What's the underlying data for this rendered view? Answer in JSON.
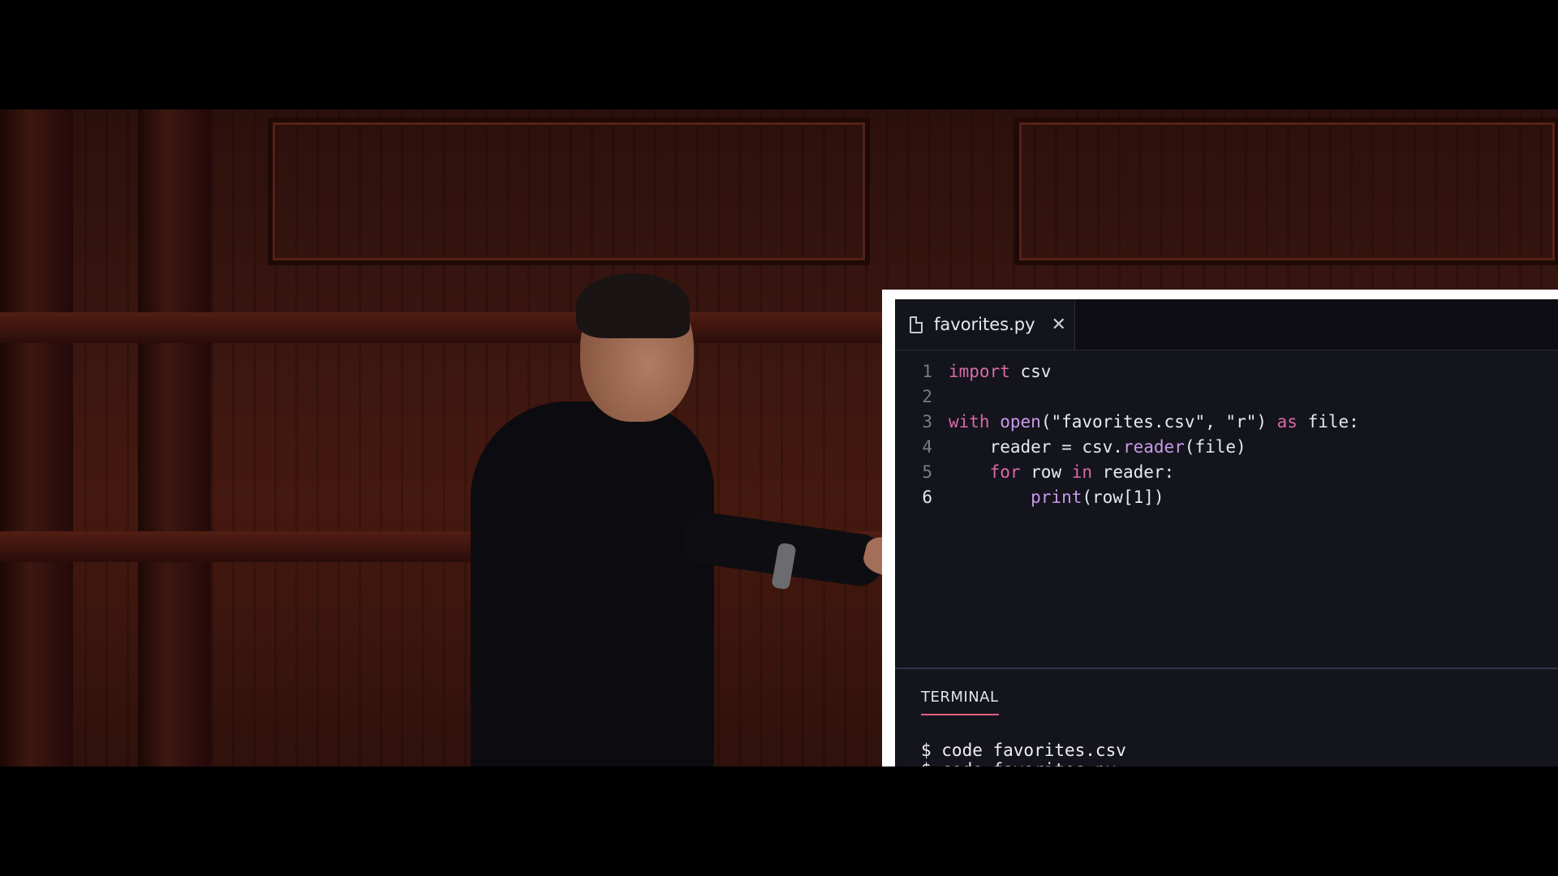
{
  "editor": {
    "tab": {
      "label": "favorites.py"
    },
    "lines": [
      {
        "number": "1",
        "tokens": [
          [
            "kw",
            "import"
          ],
          [
            "src",
            " csv"
          ]
        ]
      },
      {
        "number": "2",
        "tokens": []
      },
      {
        "number": "3",
        "tokens": [
          [
            "kw",
            "with"
          ],
          [
            "src",
            " "
          ],
          [
            "fn",
            "open"
          ],
          [
            "src",
            "("
          ],
          [
            "str",
            "\"favorites.csv\""
          ],
          [
            "src",
            ", "
          ],
          [
            "str",
            "\"r\""
          ],
          [
            "src",
            ") "
          ],
          [
            "kw",
            "as"
          ],
          [
            "src",
            " file:"
          ]
        ]
      },
      {
        "number": "4",
        "tokens": [
          [
            "src",
            "    reader = csv."
          ],
          [
            "fn",
            "reader"
          ],
          [
            "src",
            "(file)"
          ]
        ]
      },
      {
        "number": "5",
        "tokens": [
          [
            "src",
            "    "
          ],
          [
            "kw",
            "for"
          ],
          [
            "src",
            " row "
          ],
          [
            "kw",
            "in"
          ],
          [
            "src",
            " reader:"
          ]
        ]
      },
      {
        "number": "6",
        "active": true,
        "tokens": [
          [
            "src",
            "        "
          ],
          [
            "fn",
            "print"
          ],
          [
            "src",
            "(row[1])"
          ]
        ]
      }
    ]
  },
  "terminal": {
    "tab_label": "TERMINAL",
    "lines": [
      "$ code favorites.csv",
      "$ code favorites.py"
    ]
  },
  "colors": {
    "keyword": "#d96aa6",
    "function": "#c79be8",
    "terminal_accent": "#e0607e",
    "editor_bg": "#14141c"
  }
}
